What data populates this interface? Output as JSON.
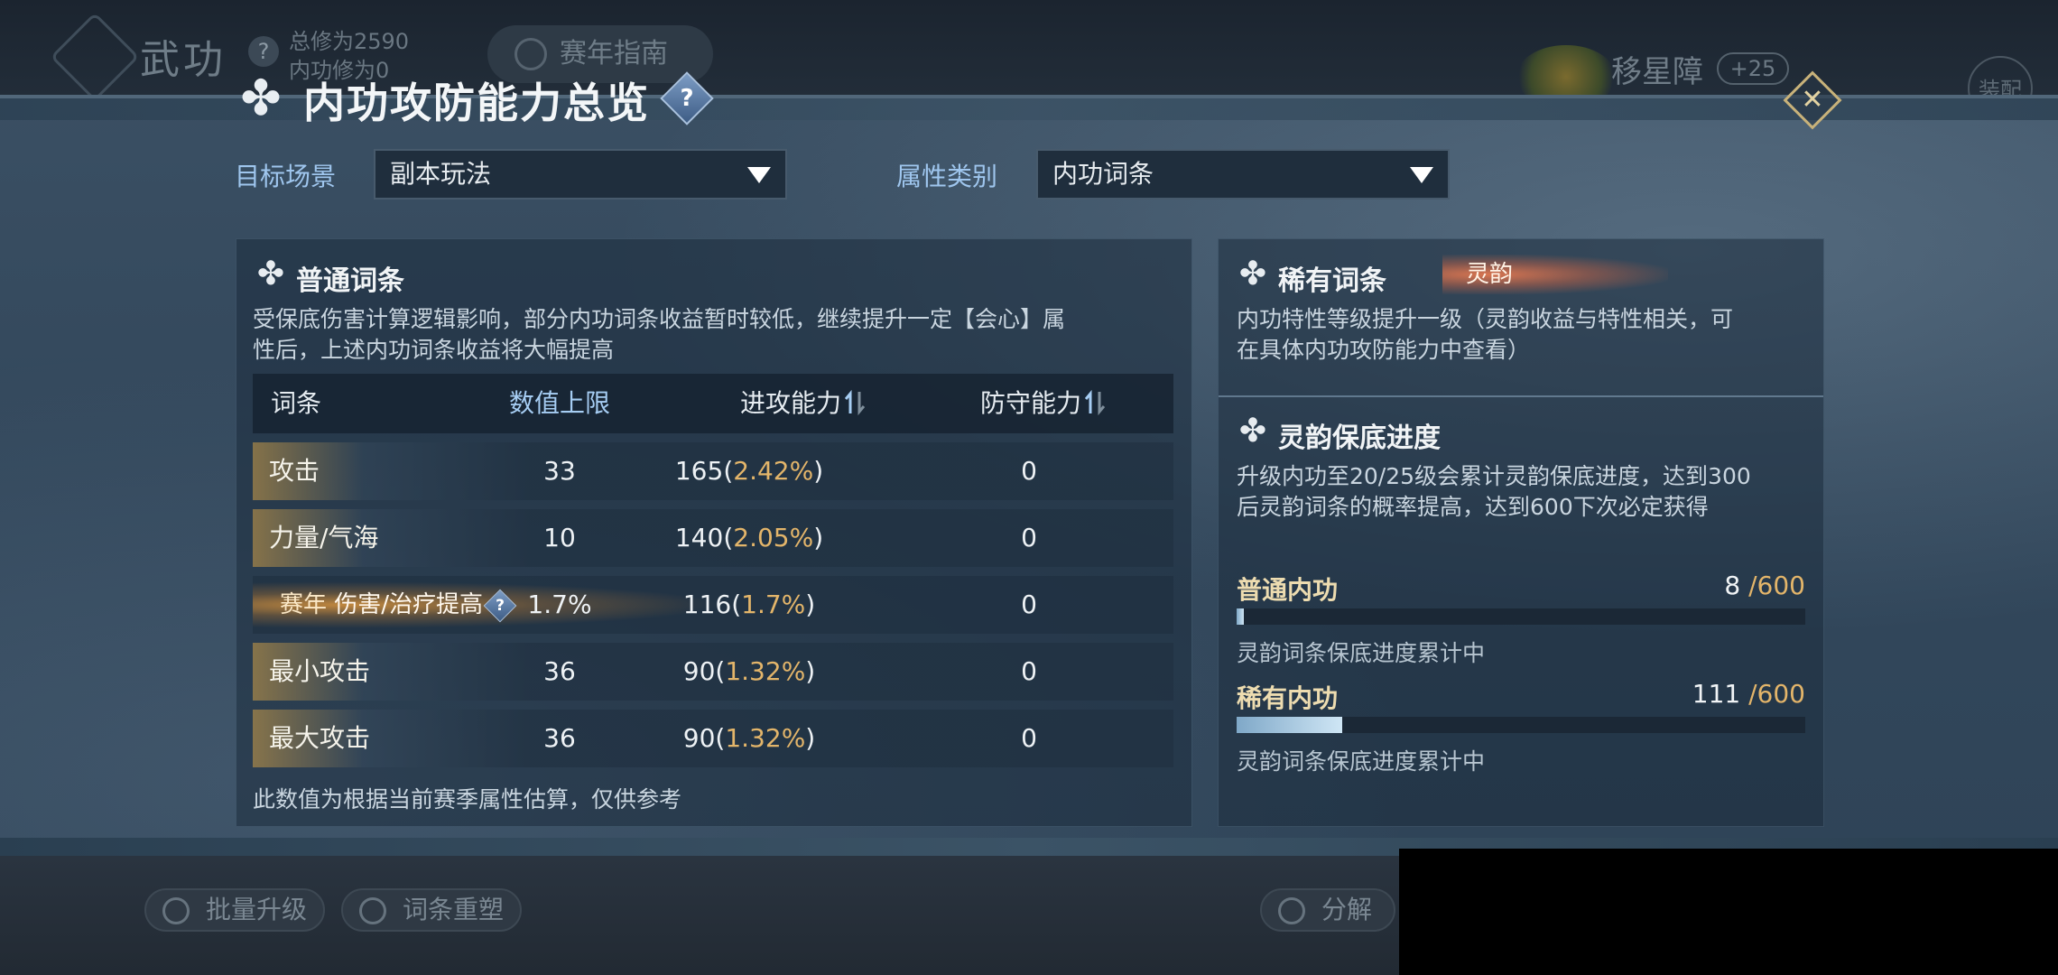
{
  "background": {
    "section_title": "武功",
    "total_cultivation": "总修为2590",
    "inner_cultivation": "内功修为0",
    "guide_label": "赛年指南",
    "character_name": "移星障",
    "character_bonus": "+25",
    "equip_label": "装配",
    "batch_upgrade": "批量升级",
    "reshape": "词条重塑",
    "decompose": "分解"
  },
  "modal": {
    "title": "内功攻防能力总览",
    "help_symbol": "?",
    "close_symbol": "✕",
    "filters": [
      {
        "label": "目标场景",
        "value": "副本玩法"
      },
      {
        "label": "属性类别",
        "value": "内功词条"
      }
    ]
  },
  "common_panel": {
    "title": "普通词条",
    "description_line1": "受保底伤害计算逻辑影响，部分内功词条收益暂时较低，继续提升一定【会心】属",
    "description_line2": "性后，上述内功词条收益将大幅提高",
    "columns": [
      "词条",
      "数值上限",
      "进攻能力",
      "防守能力"
    ],
    "rows": [
      {
        "name": "攻击",
        "cap": "33",
        "attack": "165",
        "attack_pct": "2.42%",
        "defense": "0"
      },
      {
        "name": "力量/气海",
        "cap": "10",
        "attack": "140",
        "attack_pct": "2.05%",
        "defense": "0"
      },
      {
        "badge": "赛年",
        "name": "伤害/治疗提高",
        "cap": "1.7%",
        "attack": "116",
        "attack_pct": "1.7%",
        "defense": "0"
      },
      {
        "name": "最小攻击",
        "cap": "36",
        "attack": "90",
        "attack_pct": "1.32%",
        "defense": "0"
      },
      {
        "name": "最大攻击",
        "cap": "36",
        "attack": "90",
        "attack_pct": "1.32%",
        "defense": "0"
      }
    ],
    "footnote": "此数值为根据当前赛季属性估算，仅供参考"
  },
  "rare_panel": {
    "title": "稀有词条",
    "badge": "灵韵",
    "description_line1": "内功特性等级提升一级（灵韵收益与特性相关，可",
    "description_line2": "在具体内功攻防能力中查看）"
  },
  "pity_panel": {
    "title": "灵韵保底进度",
    "description_line1": "升级内功至20/25级会累计灵韵保底进度，达到300",
    "description_line2": "后灵韵词条的概率提高，达到600下次必定获得",
    "bars": [
      {
        "label": "普通内功",
        "current": "8",
        "max": "/600",
        "progress": 0.0133,
        "note": "灵韵词条保底进度累计中"
      },
      {
        "label": "稀有内功",
        "current": "111",
        "max": "/600",
        "progress": 0.185,
        "note": "灵韵词条保底进度累计中"
      }
    ]
  },
  "colors": {
    "accent_blue": "#a6cdf3",
    "gold": "#e3b56a",
    "rare_orange": "#e17850"
  }
}
